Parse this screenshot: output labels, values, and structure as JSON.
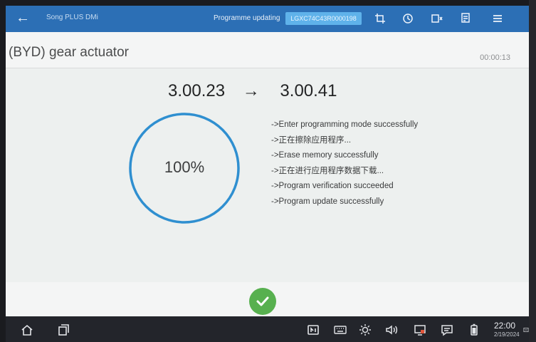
{
  "header": {
    "back_label": "←",
    "vehicle": "Song PLUS DMi",
    "status": "Programme updating",
    "vin": "LGXC74C43R0000198",
    "icons": [
      "screenshot-icon",
      "history-icon",
      "vci-icon",
      "report-icon",
      "menu-icon"
    ]
  },
  "page": {
    "title": "(BYD) gear actuator",
    "timer": "00:00:13"
  },
  "update": {
    "version_from": "3.00.23",
    "arrow": "→",
    "version_to": "3.00.41",
    "progress_text": "100%",
    "progress": 1.0,
    "log": [
      "->Enter programming mode successfully",
      "->正在擦除应用程序...",
      "->Erase memory successfully",
      "->正在进行应用程序数据下载...",
      "->Program verification succeeded",
      "->Program update successfully"
    ]
  },
  "colors": {
    "accent": "#2c6fb5",
    "ring": "#2f8fd0",
    "success": "#57b04f"
  },
  "taskbar": {
    "time": "22:00",
    "date": "2/19/2024",
    "icons": [
      "home-icon",
      "recent-apps-icon",
      "app-switch-icon",
      "keyboard-icon",
      "brightness-icon",
      "volume-icon",
      "screen-record-icon",
      "message-icon",
      "battery-icon",
      "exit-icon"
    ]
  }
}
